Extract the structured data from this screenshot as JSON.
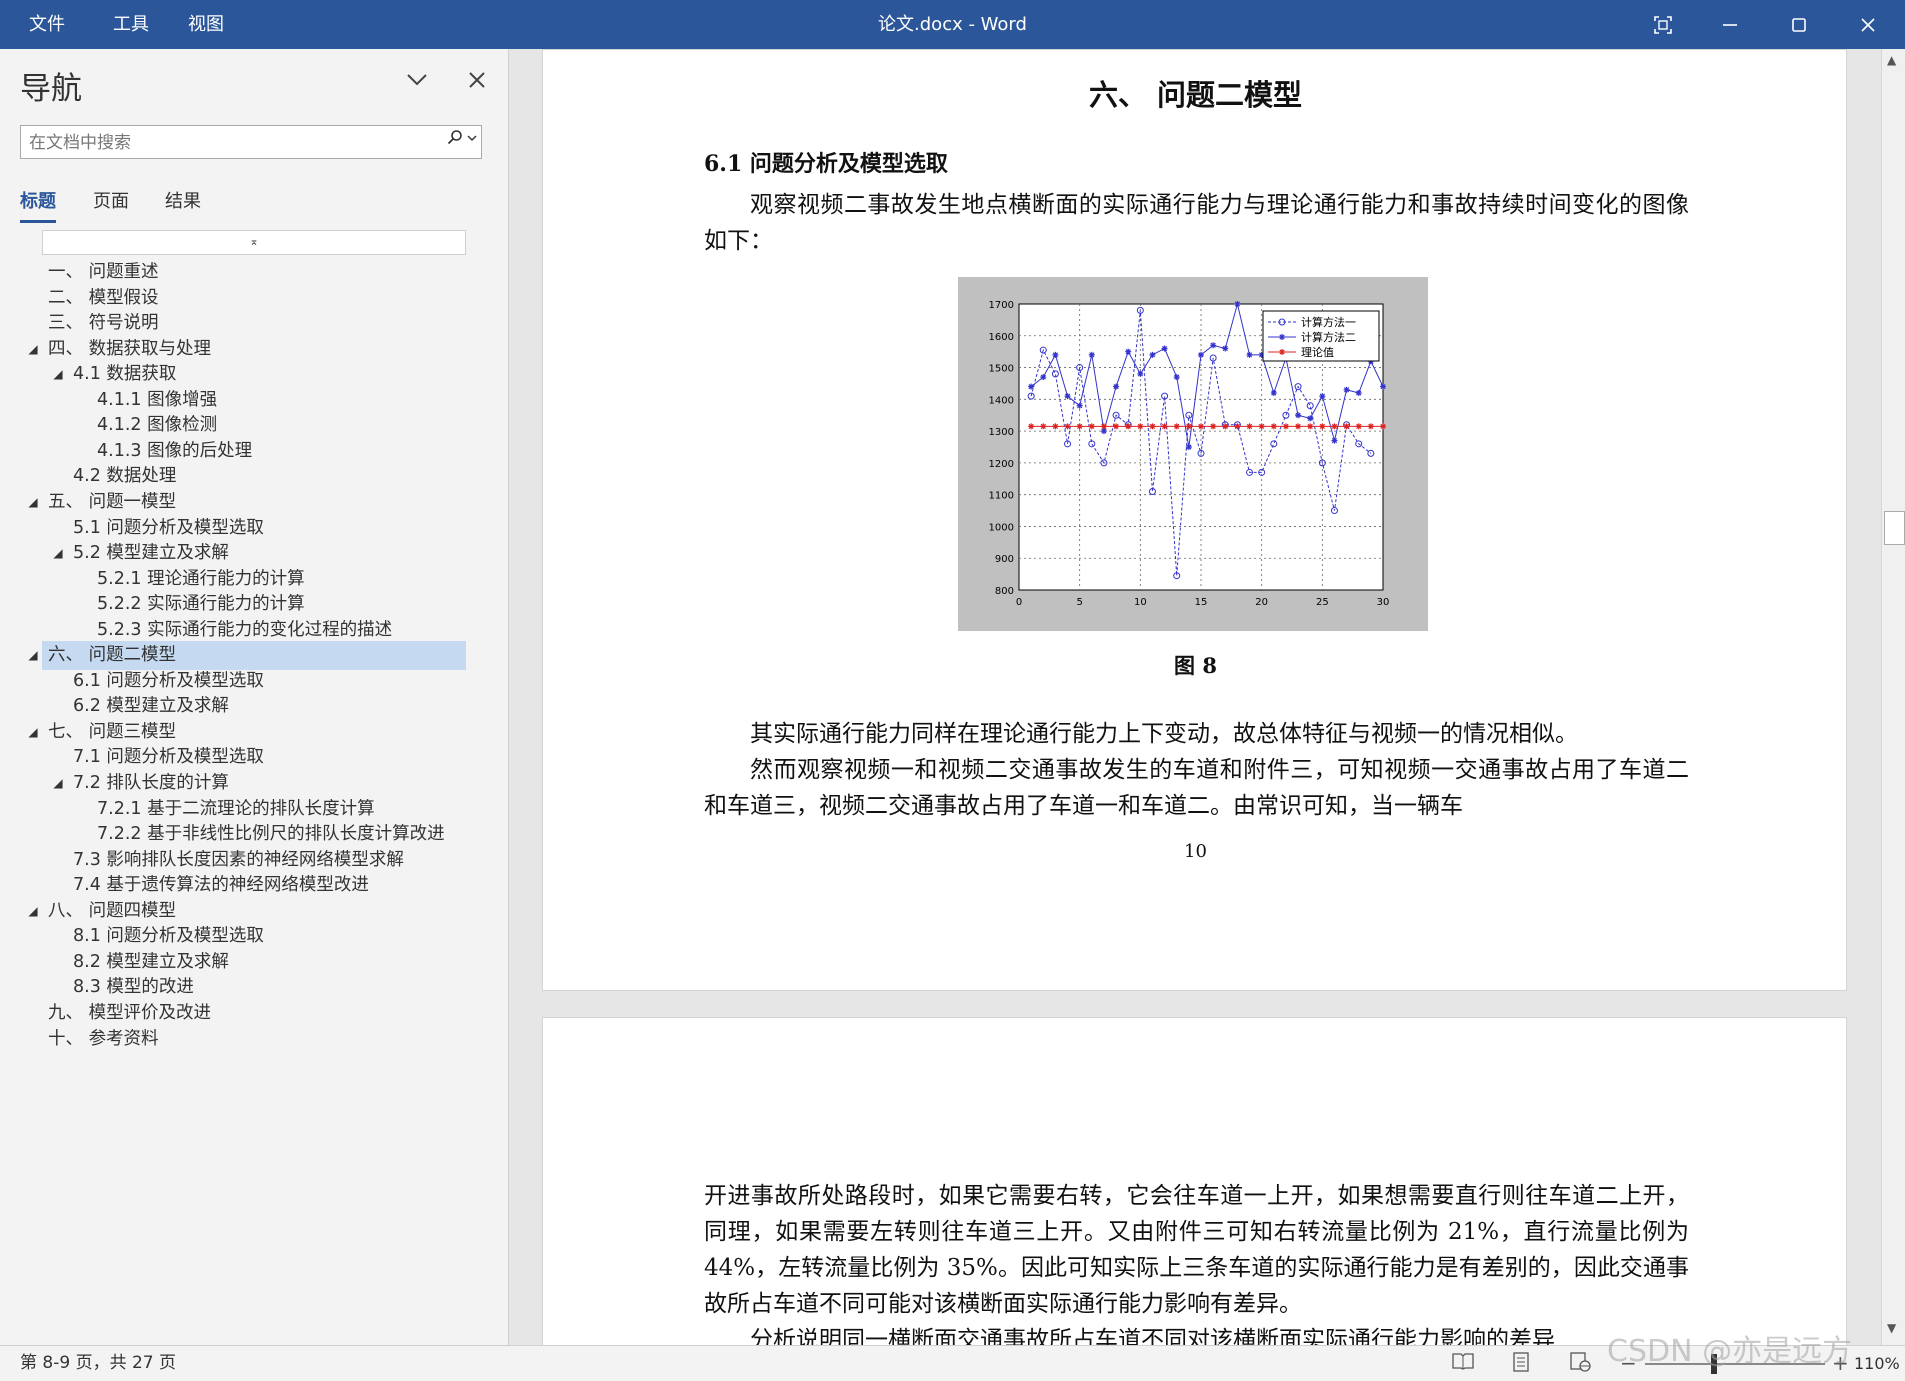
{
  "titlebar": {
    "menu": [
      "文件",
      "工具",
      "视图"
    ],
    "title": "论文.docx  -  Word",
    "icons": [
      "fullscreen-icon",
      "minimize-icon",
      "maximize-icon",
      "close-icon"
    ]
  },
  "nav": {
    "title": "导航",
    "search_placeholder": "在文档中搜索",
    "tabs": [
      "标题",
      "页面",
      "结果"
    ],
    "collapse_glyph": "⌅",
    "headings": [
      {
        "label": "一、 问题重述",
        "level": 1,
        "toggle": false
      },
      {
        "label": "二、 模型假设",
        "level": 1,
        "toggle": false
      },
      {
        "label": "三、 符号说明",
        "level": 1,
        "toggle": false
      },
      {
        "label": "四、 数据获取与处理",
        "level": 1,
        "toggle": true
      },
      {
        "label": "4.1 数据获取",
        "level": 2,
        "toggle": true
      },
      {
        "label": "4.1.1 图像增强",
        "level": 3,
        "toggle": false
      },
      {
        "label": "4.1.2 图像检测",
        "level": 3,
        "toggle": false
      },
      {
        "label": "4.1.3 图像的后处理",
        "level": 3,
        "toggle": false
      },
      {
        "label": "4.2 数据处理",
        "level": 2,
        "toggle": false
      },
      {
        "label": "五、 问题一模型",
        "level": 1,
        "toggle": true
      },
      {
        "label": "5.1 问题分析及模型选取",
        "level": 2,
        "toggle": false
      },
      {
        "label": "5.2 模型建立及求解",
        "level": 2,
        "toggle": true
      },
      {
        "label": "5.2.1 理论通行能力的计算",
        "level": 3,
        "toggle": false
      },
      {
        "label": "5.2.2 实际通行能力的计算",
        "level": 3,
        "toggle": false
      },
      {
        "label": "5.2.3 实际通行能力的变化过程的描述",
        "level": 3,
        "toggle": false
      },
      {
        "label": "六、 问题二模型",
        "level": 1,
        "toggle": true,
        "selected": true
      },
      {
        "label": "6.1 问题分析及模型选取",
        "level": 2,
        "toggle": false
      },
      {
        "label": "6.2 模型建立及求解",
        "level": 2,
        "toggle": false
      },
      {
        "label": "七、 问题三模型",
        "level": 1,
        "toggle": true
      },
      {
        "label": "7.1 问题分析及模型选取",
        "level": 2,
        "toggle": false
      },
      {
        "label": "7.2 排队长度的计算",
        "level": 2,
        "toggle": true
      },
      {
        "label": "7.2.1 基于二流理论的排队长度计算",
        "level": 3,
        "toggle": false
      },
      {
        "label": "7.2.2 基于非线性比例尺的排队长度计算改进",
        "level": 3,
        "toggle": false
      },
      {
        "label": "7.3 影响排队长度因素的神经网络模型求解",
        "level": 2,
        "toggle": false
      },
      {
        "label": "7.4 基于遗传算法的神经网络模型改进",
        "level": 2,
        "toggle": false
      },
      {
        "label": "八、 问题四模型",
        "level": 1,
        "toggle": true
      },
      {
        "label": "8.1 问题分析及模型选取",
        "level": 2,
        "toggle": false
      },
      {
        "label": "8.2 模型建立及求解",
        "level": 2,
        "toggle": false
      },
      {
        "label": "8.3 模型的改进",
        "level": 2,
        "toggle": false
      },
      {
        "label": "九、 模型评价及改进",
        "level": 1,
        "toggle": false
      },
      {
        "label": "十、 参考资料",
        "level": 1,
        "toggle": false
      }
    ]
  },
  "document": {
    "page1": {
      "heading": "六、 问题二模型",
      "subheading": "6.1 问题分析及模型选取",
      "para1": "观察视频二事故发生地点横断面的实际通行能力与理论通行能力和事故持续时间变化的图像如下：",
      "figure_caption": "图 8",
      "para2": "其实际通行能力同样在理论通行能力上下变动，故总体特征与视频一的情况相似。",
      "para3": "然而观察视频一和视频二交通事故发生的车道和附件三，可知视频一交通事故占用了车道二和车道三，视频二交通事故占用了车道一和车道二。由常识可知，当一辆车",
      "page_number": "10"
    },
    "page2": {
      "para1": "开进事故所处路段时，如果它需要右转，它会往车道一上开，如果想需要直行则往车道二上开，同理，如果需要左转则往车道三上开。又由附件三可知右转流量比例为 21%，直行流量比例为 44%，左转流量比例为 35%。因此可知实际上三条车道的实际通行能力是有差别的，因此交通事故所占车道不同可能对该横断面实际通行能力影响有差异。",
      "para2": "分析说明同一横断面交通事故所占车道不同对该横断面实际通行能力影响的差异"
    }
  },
  "chart_data": {
    "type": "line",
    "xlim": [
      0,
      30
    ],
    "ylim": [
      800,
      1700
    ],
    "xticks": [
      0,
      5,
      10,
      15,
      20,
      25,
      30
    ],
    "yticks": [
      800,
      900,
      1000,
      1100,
      1200,
      1300,
      1400,
      1500,
      1600,
      1700
    ],
    "grid": true,
    "legend_position": "top-right",
    "series": [
      {
        "name": "计算方法一",
        "color": "#3333cc",
        "marker": "circle",
        "dash": true,
        "x": [
          1,
          2,
          3,
          4,
          5,
          6,
          7,
          8,
          9,
          10,
          11,
          12,
          13,
          14,
          15,
          16,
          17,
          18,
          19,
          20,
          21,
          22,
          23,
          24,
          25,
          26,
          27,
          28,
          29
        ],
        "y": [
          1410,
          1555,
          1480,
          1260,
          1500,
          1260,
          1200,
          1350,
          1320,
          1680,
          1110,
          1410,
          845,
          1350,
          1230,
          1530,
          1320,
          1320,
          1170,
          1170,
          1260,
          1350,
          1440,
          1380,
          1200,
          1050,
          1320,
          1260,
          1230
        ]
      },
      {
        "name": "计算方法二",
        "color": "#3333cc",
        "marker": "star",
        "dash": false,
        "x": [
          1,
          2,
          3,
          4,
          5,
          6,
          7,
          8,
          9,
          10,
          11,
          12,
          13,
          14,
          15,
          16,
          17,
          18,
          19,
          20,
          21,
          22,
          23,
          24,
          25,
          26,
          27,
          28,
          29,
          30
        ],
        "y": [
          1440,
          1470,
          1540,
          1410,
          1380,
          1540,
          1300,
          1440,
          1550,
          1480,
          1540,
          1560,
          1470,
          1250,
          1540,
          1570,
          1560,
          1700,
          1540,
          1540,
          1420,
          1530,
          1350,
          1340,
          1410,
          1270,
          1430,
          1420,
          1520,
          1440
        ]
      },
      {
        "name": "理论值",
        "color": "#dd2222",
        "marker": "star",
        "dash": false,
        "x": [
          1,
          2,
          3,
          4,
          5,
          6,
          7,
          8,
          9,
          10,
          11,
          12,
          13,
          14,
          15,
          16,
          17,
          18,
          19,
          20,
          21,
          22,
          23,
          24,
          25,
          26,
          27,
          28,
          29,
          30
        ],
        "y": [
          1315,
          1315,
          1315,
          1315,
          1315,
          1315,
          1315,
          1315,
          1315,
          1315,
          1315,
          1315,
          1315,
          1315,
          1315,
          1315,
          1315,
          1315,
          1315,
          1315,
          1315,
          1315,
          1315,
          1315,
          1315,
          1315,
          1315,
          1315,
          1315,
          1315
        ]
      }
    ]
  },
  "status": {
    "page_info": "第 8-9 页，共 27 页",
    "zoom": "110%",
    "view_icons": [
      "read-mode-icon",
      "print-layout-icon",
      "web-layout-icon"
    ],
    "zoom_level_percent": 110
  },
  "watermark": "CSDN @亦是远方"
}
